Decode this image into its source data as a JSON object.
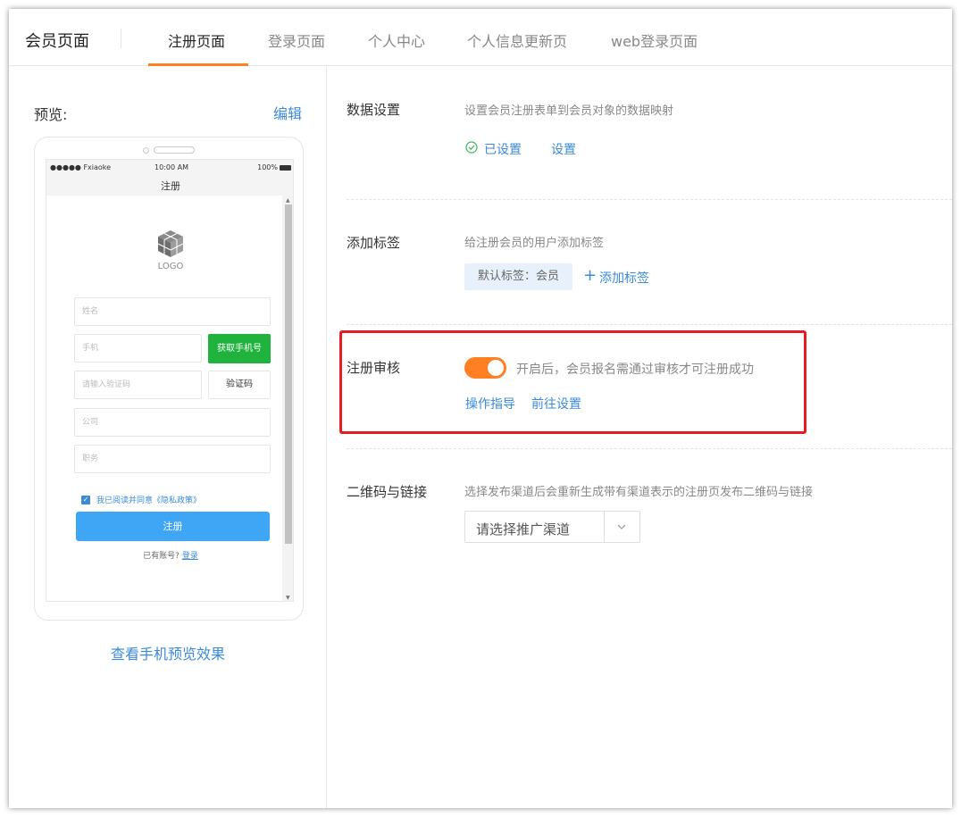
{
  "header": {
    "title": "会员页面",
    "tabs": [
      {
        "label": "注册页面",
        "active": true
      },
      {
        "label": "登录页面",
        "active": false
      },
      {
        "label": "个人中心",
        "active": false
      },
      {
        "label": "个人信息更新页",
        "active": false
      },
      {
        "label": "web登录页面",
        "active": false
      }
    ]
  },
  "preview": {
    "label": "预览:",
    "edit": "编辑",
    "view_link": "查看手机预览效果",
    "phone": {
      "carrier": "●●●●● Fxiaoke",
      "time": "10:00 AM",
      "battery": "100%",
      "title": "注册",
      "logo_text": "LOGO",
      "fields": {
        "name": "姓名",
        "phone": "手机",
        "code": "请输入验证码",
        "company": "公司",
        "position": "职务"
      },
      "get_phone_button": "获取手机号",
      "code_button": "验证码",
      "agree_text": "我已阅读并同意《隐私政策》",
      "register_button": "注册",
      "have_account": "已有账号?",
      "login_link": "登录"
    }
  },
  "sections": {
    "data_settings": {
      "title": "数据设置",
      "desc": "设置会员注册表单到会员对象的数据映射",
      "status": "已设置",
      "action": "设置"
    },
    "tags": {
      "title": "添加标签",
      "desc": "给注册会员的用户添加标签",
      "default_tag": "默认标签：会员",
      "add": "添加标签"
    },
    "review": {
      "title": "注册审核",
      "toggle_on": true,
      "desc": "开启后，会员报名需通过审核才可注册成功",
      "guide": "操作指导",
      "goto": "前往设置"
    },
    "qrcode": {
      "title": "二维码与链接",
      "desc": "选择发布渠道后会重新生成带有渠道表示的注册页发布二维码与链接",
      "select_placeholder": "请选择推广渠道"
    }
  },
  "colors": {
    "accent": "#ff7f22",
    "link": "#3b8bd8",
    "highlight_border": "#e51c23",
    "get_phone_green": "#1fb23d",
    "register_blue": "#3ea6f5"
  }
}
